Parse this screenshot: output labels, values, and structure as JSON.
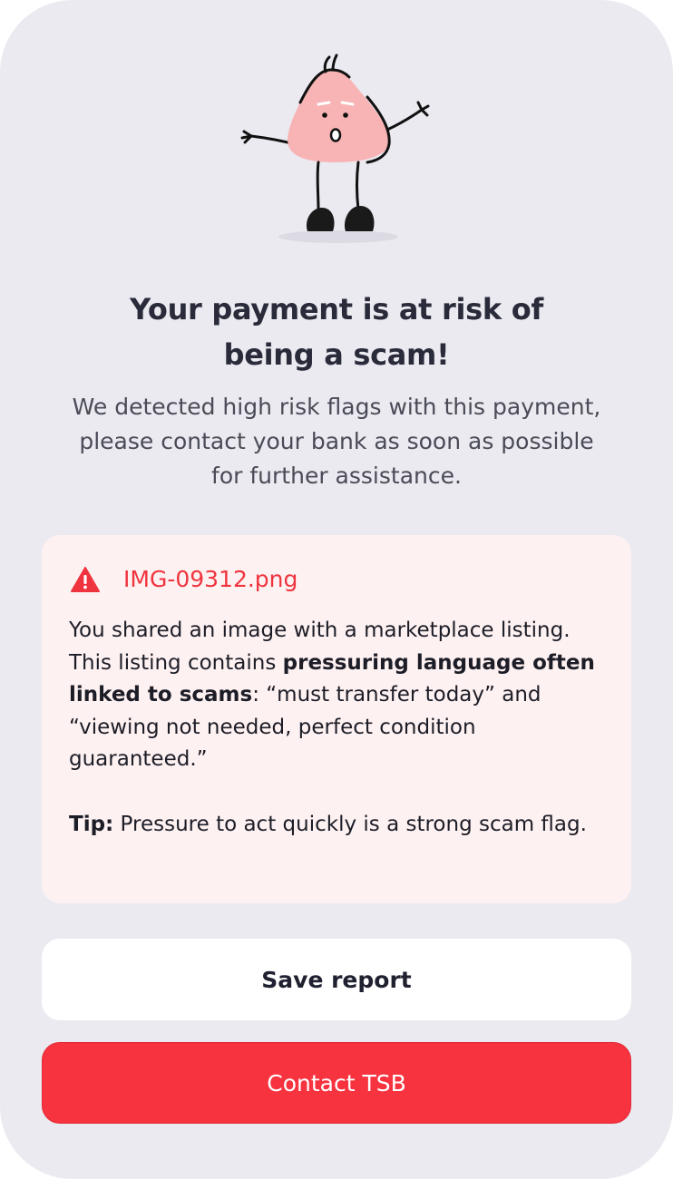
{
  "alert": {
    "headline_line1": "Your payment is at risk of",
    "headline_line2": "being a scam!",
    "subtext_line1": "We detected high risk flags with this payment,",
    "subtext_line2": "please contact your bank as soon as possible",
    "subtext_line3": "for further assistance."
  },
  "card": {
    "icon": "warning-triangle-icon",
    "filename": "IMG-09312.png",
    "body_part1": "You shared an image with a marketplace listing. This listing contains ",
    "body_bold": "pressuring language often linked to scams",
    "body_part2": ": “must transfer today” and “viewing not needed, perfect condition guaranteed.”",
    "tip_label": "Tip:",
    "tip_text": " Pressure to act quickly is a strong scam flag."
  },
  "buttons": {
    "save_label": "Save report",
    "contact_label": "Contact TSB"
  },
  "colors": {
    "background": "#ebeaf1",
    "accent_red": "#f7333f",
    "card_background": "#fdf1f1",
    "character_pink": "#f8b4b4"
  }
}
